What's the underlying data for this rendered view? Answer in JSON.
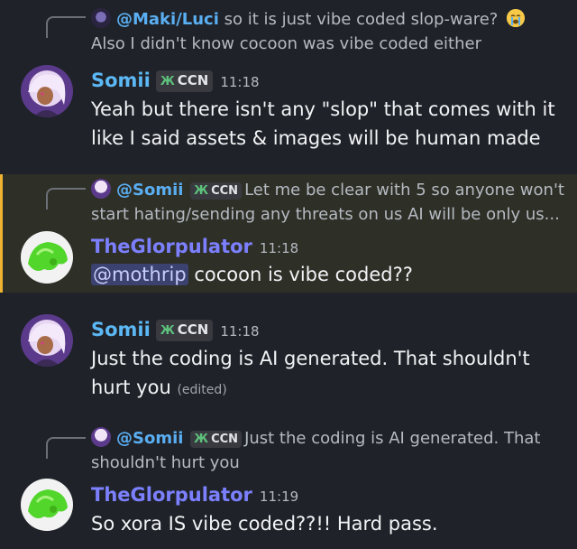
{
  "messages": [
    {
      "reply": {
        "name": "@Maki/Luci",
        "text": "so it is just vibe coded slop-ware?",
        "emoji": "loudly-crying-emoji",
        "line2": "Also I didn't know cocoon was vibe coded either"
      },
      "author": "Somii",
      "tag": "CCN",
      "time": "11:18",
      "lines": [
        "Yeah but there isn't any \"slop\" that comes with it",
        "like I said assets & images will be human made"
      ]
    },
    {
      "reply": {
        "name": "@Somii",
        "tag": "CCN",
        "text": "Let me be clear with 5 so anyone won't",
        "line2": "start hating/sending any threats on us  AI will be only us..."
      },
      "author": "TheGlorpulator",
      "time": "11:18",
      "mention": "@mothrip",
      "text": " cocoon is vibe coded??"
    },
    {
      "author": "Somii",
      "tag": "CCN",
      "time": "11:18",
      "lines": [
        "Just the coding is AI generated. That shouldn't",
        "hurt you"
      ],
      "edited": "(edited)"
    },
    {
      "reply": {
        "name": "@Somii",
        "tag": "CCN",
        "text": "Just the coding is AI generated. That",
        "line2": "shouldn't hurt you"
      },
      "author": "TheGlorpulator",
      "time": "11:19",
      "text": "So xora IS vibe coded??!! Hard pass."
    }
  ],
  "colors": {
    "somii": "#5cb8f5",
    "glorp": "#7c80ff",
    "highlight_bar": "#f0b232",
    "background": "#1f2329"
  }
}
